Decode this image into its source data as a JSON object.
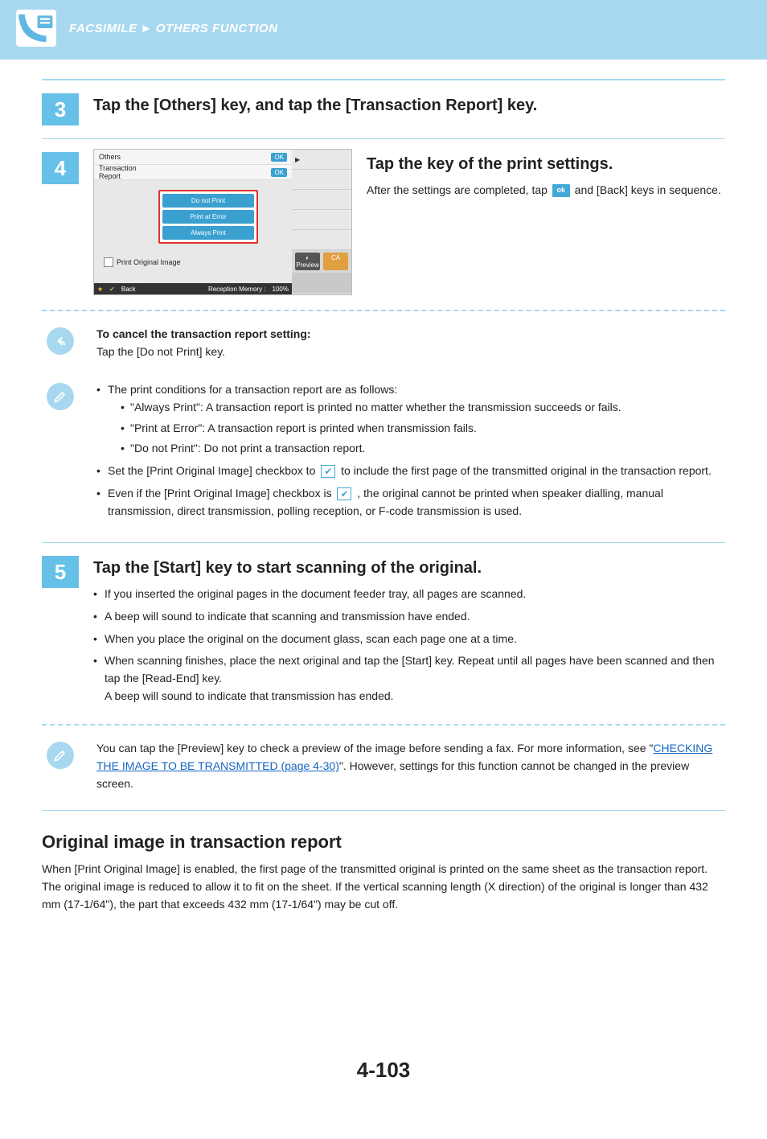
{
  "header": {
    "breadcrumb_left": "FACSIMILE",
    "breadcrumb_sep": "►",
    "breadcrumb_right": "OTHERS FUNCTION"
  },
  "step3": {
    "num": "3",
    "title": "Tap the [Others] key, and tap the [Transaction Report] key."
  },
  "step4": {
    "num": "4",
    "title": "Tap the key of the print settings.",
    "body_pre": "After the settings are completed, tap ",
    "ok_chip": "ok",
    "body_post": " and [Back] keys in sequence.",
    "mock": {
      "others": "Others",
      "transaction_report": "Transaction\nReport",
      "do_not_print": "Do not Print",
      "print_at_error": "Print at Error",
      "always_print": "Always Print",
      "print_original_image": "Print Original Image",
      "back": "Back",
      "reception_memory": "Reception Memory :",
      "percent": "100%",
      "preview": "Preview",
      "ca": "CA",
      "ok": "OK"
    }
  },
  "cancel_note": {
    "title": "To cancel the transaction report setting:",
    "body": "Tap the [Do not Print] key."
  },
  "info_note": {
    "lead": "The print conditions for a transaction report are as follows:",
    "opt1": "\"Always Print\": A transaction report is printed no matter whether the transmission succeeds or fails.",
    "opt2": "\"Print at Error\": A transaction report is printed when transmission fails.",
    "opt3": "\"Do not Print\": Do not print a transaction report.",
    "b2_pre": "Set the [Print Original Image] checkbox to ",
    "b2_post": " to include the first page of the transmitted original in the transaction report.",
    "b3_pre": "Even if the [Print Original Image] checkbox is ",
    "b3_post": " , the original cannot be printed when speaker dialling, manual transmission, direct transmission, polling reception, or F-code transmission is used."
  },
  "step5": {
    "num": "5",
    "title": "Tap the [Start] key to start scanning of the original.",
    "b1": "If you inserted the original pages in the document feeder tray, all pages are scanned.",
    "b2": "A beep will sound to indicate that scanning and transmission have ended.",
    "b3": "When you place the original on the document glass, scan each page one at a time.",
    "b4": "When scanning finishes, place the next original and tap the [Start] key. Repeat until all pages have been scanned and then tap the [Read-End] key.",
    "b4_tail": "A beep will sound to indicate that transmission has ended."
  },
  "preview_note": {
    "pre": "You can tap the [Preview] key to check a preview of the image before sending a fax. For more information, see \"",
    "link": "CHECKING THE IMAGE TO BE TRANSMITTED (page 4-30)",
    "post": "\". However, settings for this function cannot be changed in the preview screen."
  },
  "section": {
    "heading": "Original image in transaction report",
    "body": "When [Print Original Image] is enabled, the first page of the transmitted original is printed on the same sheet as the transaction report. The original image is reduced to allow it to fit on the sheet. If the vertical scanning length (X direction) of the original is longer than 432 mm (17-1/64\"), the part that exceeds 432 mm (17-1/64\") may be cut off."
  },
  "page_number": "4-103"
}
